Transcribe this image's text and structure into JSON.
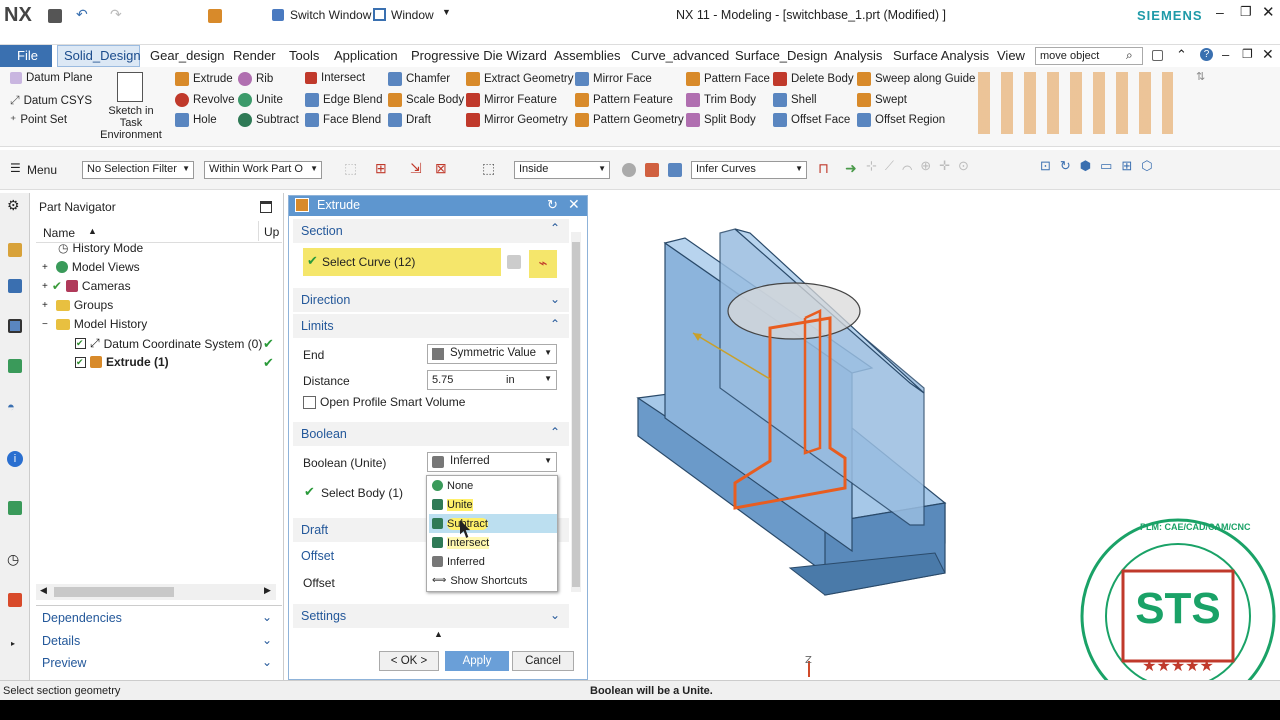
{
  "app": {
    "logo": "NX",
    "title": "NX 11 - Modeling - [switchbase_1.prt (Modified) ]",
    "brand": "SIEMENS",
    "switch_window": "Switch Window",
    "window": "Window"
  },
  "tabs": [
    "File",
    "Solid_Design",
    "Gear_design",
    "Render",
    "Tools",
    "Application",
    "Progressive Die Wizard",
    "Assemblies",
    "Curve_advanced",
    "Surface_Design",
    "Analysis",
    "Surface Analysis",
    "View"
  ],
  "search": {
    "value": "move object"
  },
  "ribbon": {
    "col1": [
      "Datum Plane",
      "Datum CSYS",
      "Point Set"
    ],
    "sketch": "Sketch in Task Environment",
    "col2": [
      "Extrude",
      "Revolve",
      "Hole"
    ],
    "col3": [
      "Rib",
      "Unite",
      "Subtract"
    ],
    "col4": [
      "Intersect",
      "Edge Blend",
      "Face Blend"
    ],
    "col5": [
      "Chamfer",
      "Scale Body",
      "Draft"
    ],
    "col6": [
      "Extract Geometry",
      "Mirror Feature",
      "Mirror Geometry"
    ],
    "col7": [
      "Mirror Face",
      "Pattern Feature",
      "Pattern Geometry"
    ],
    "col8": [
      "Pattern Face",
      "Trim Body",
      "Split Body"
    ],
    "col9": [
      "Delete Body",
      "Shell",
      "Offset Face"
    ],
    "col10": [
      "Sweep along Guide",
      "Swept",
      "Offset Region"
    ]
  },
  "filterbar": {
    "menu": "Menu",
    "filter": "No Selection Filter",
    "scope": "Within Work Part O",
    "inside": "Inside",
    "curves": "Infer Curves"
  },
  "partnav": {
    "title": "Part Navigator",
    "col_name": "Name",
    "col_up": "Up",
    "items": [
      "History Mode",
      "Model Views",
      "Cameras",
      "Groups",
      "Model History",
      "Datum Coordinate System (0)",
      "Extrude (1)"
    ],
    "footer": [
      "Dependencies",
      "Details",
      "Preview"
    ]
  },
  "dialog": {
    "title": "Extrude",
    "section": "Section",
    "select_curve": "Select Curve (12)",
    "direction": "Direction",
    "limits": "Limits",
    "end_label": "End",
    "end_value": "Symmetric Value",
    "distance_label": "Distance",
    "distance_value": "5.75",
    "distance_unit": "in",
    "open_profile": "Open Profile Smart Volume",
    "boolean": "Boolean",
    "boolean_label": "Boolean (Unite)",
    "boolean_value": "Inferred",
    "select_body": "Select Body (1)",
    "draft": "Draft",
    "offset": "Offset",
    "offset_label": "Offset",
    "settings": "Settings",
    "ok": "< OK >",
    "apply": "Apply",
    "cancel": "Cancel"
  },
  "dropdown": [
    "None",
    "Unite",
    "Subtract",
    "Intersect",
    "Inferred",
    "Show Shortcuts"
  ],
  "status": {
    "left": "Select section geometry",
    "center": "Boolean will be a Unite."
  },
  "logo": {
    "text": "STS",
    "ring": "PLM: CAE/CAD/CAM/CNC",
    "ring2": "SMART TRAINING - TECHNOLOGY - TRANSFORMATION SOLUTIONS",
    "stars": "★★★★★"
  },
  "colors": {
    "accent": "#5e96cf",
    "highlight": "#f5e66b",
    "model": "#8cb4dc",
    "edge": "#e85d20",
    "logo": "#1aa267"
  }
}
